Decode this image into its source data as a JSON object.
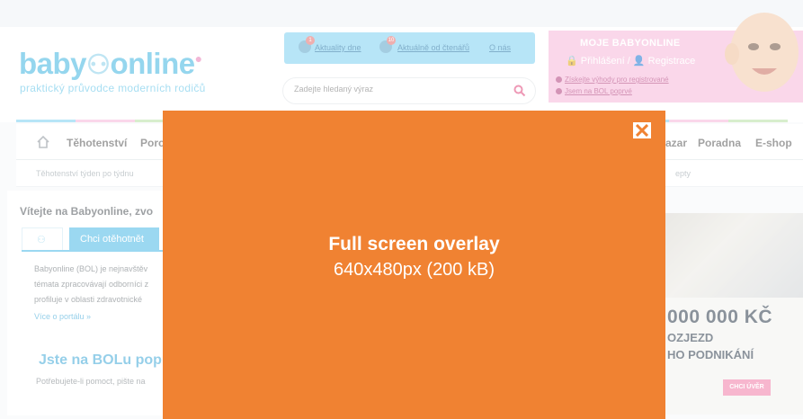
{
  "header": {
    "logo_text_1": "baby",
    "logo_text_2": "online",
    "logo_tagline": "praktický průvodce moderních rodičů",
    "news": [
      {
        "label": "Aktuality dne",
        "badge": "1"
      },
      {
        "label": "Aktuálně od čtenářů",
        "badge": "10"
      },
      {
        "label": "O nás",
        "badge": ""
      }
    ],
    "search_placeholder": "Zadejte hledaný výraz",
    "bol": {
      "title": "MOJE BABYONLINE",
      "login": "Přihlášení",
      "separator": "/",
      "register": "Registrace",
      "link_1": "Získejte výhody pro registrované",
      "link_2": "Jsem na BOL poprvé"
    }
  },
  "nav": {
    "items": [
      "Těhotenství",
      "Poro",
      "azar",
      "Poradna",
      "E-shop"
    ]
  },
  "subnav": {
    "items": [
      "Těhotenství týden po týdnu",
      "epty"
    ]
  },
  "main": {
    "welcome": "Vítejte na Babyonline, zvo",
    "tab_label": "Chci otěhotnět",
    "paragraph": [
      "Babyonline (BOL) je nejnavštěv",
      "témata zpracovávají odborníci z",
      "profiluje v oblasti zdravotnické"
    ],
    "more_link": "Více o portálu »",
    "bol_first": "Jste na BOLu poprv",
    "need_help": "Potřebujete-li pomoct, pište na"
  },
  "ad_right": {
    "line1": "000 000 KČ",
    "line2": "OZJEZD",
    "line3": "HO PODNIKÁNÍ",
    "cta": "CHCI ÚVĚR"
  },
  "overlay": {
    "title": "Full screen overlay",
    "subtitle": "640x480px (200 kB)",
    "close_icon": "close-icon",
    "background_color": "#f08232"
  },
  "colors": {
    "brand_blue": "#3fb5e0",
    "brand_pink": "#f6b6d9",
    "overlay_orange": "#f08232"
  }
}
